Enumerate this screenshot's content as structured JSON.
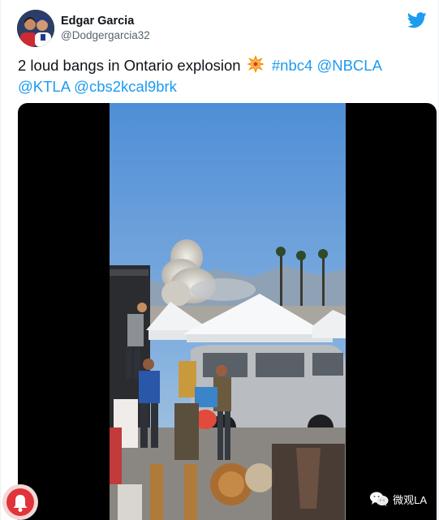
{
  "tweet": {
    "author": {
      "display_name": "Edgar Garcia",
      "handle": "@Dodgergarcia32"
    },
    "text_plain": "2 loud bangs in Ontario explosion",
    "hashtag": "#nbc4",
    "mentions": [
      "@NBCLA",
      "@KTLA",
      "@cbs2kcal9brk"
    ],
    "emoji": "collision-emoji"
  },
  "media": {
    "type": "video",
    "description_icon": "video-player"
  },
  "overlay": {
    "notification_icon": "bell-icon",
    "watermark": "微观LA",
    "watermark_icon": "wechat-icon"
  },
  "colors": {
    "link": "#1d9bf0",
    "text": "#0f1419",
    "secondary": "#536471",
    "twitter_blue": "#1d9bf0",
    "notif_red": "#e0333a"
  }
}
